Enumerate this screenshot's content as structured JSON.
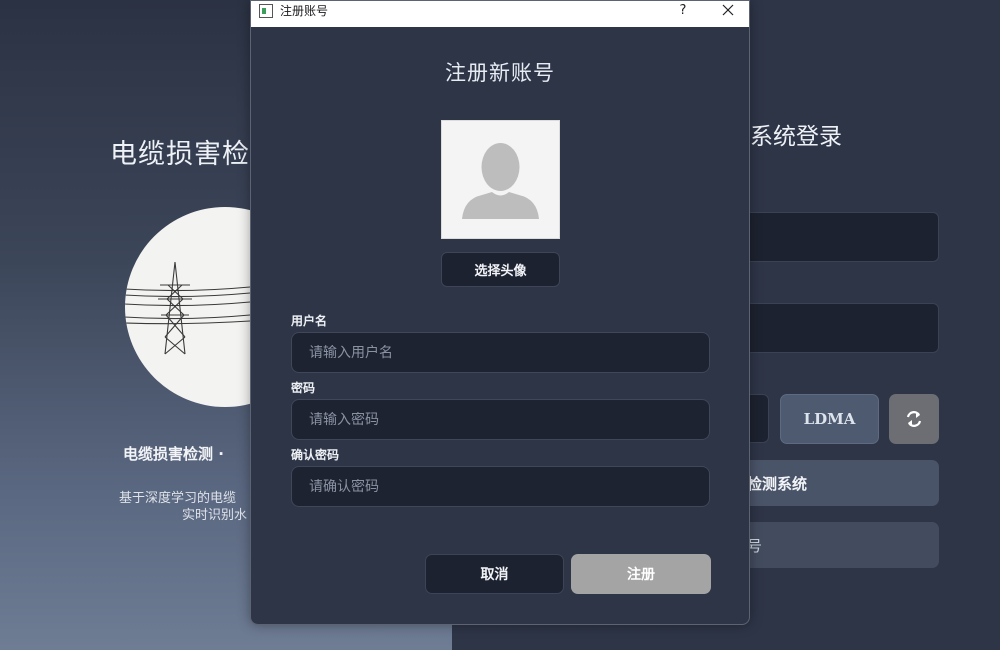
{
  "background_window": {
    "left": {
      "title": "电缆损害检",
      "subtitle": "电缆损害检测  ·",
      "description_line1": "基于深度学习的电缆",
      "description_line2": "实时识别水"
    },
    "login": {
      "title": "系统登录",
      "captcha_code": "LDMA",
      "login_button": "检测系统",
      "register_button": "号"
    }
  },
  "dialog": {
    "window_title": "注册账号",
    "help_label": "?",
    "heading": "注册新账号",
    "choose_avatar_label": "选择头像",
    "fields": {
      "username": {
        "label": "用户名",
        "placeholder": "请输入用户名",
        "value": ""
      },
      "password": {
        "label": "密码",
        "placeholder": "请输入密码",
        "value": ""
      },
      "confirm_password": {
        "label": "确认密码",
        "placeholder": "请确认密码",
        "value": ""
      }
    },
    "cancel_label": "取消",
    "register_label": "注册"
  },
  "icons": {
    "avatar": "user-silhouette-icon",
    "tower": "power-tower-icon",
    "refresh": "refresh-icon",
    "close": "close-icon",
    "app": "app-window-icon"
  },
  "colors": {
    "dialog_bg": "#2d3547",
    "field_bg": "#1e2331",
    "register_button": "#a4a4a4",
    "captcha_bg": "#4d5a70"
  }
}
